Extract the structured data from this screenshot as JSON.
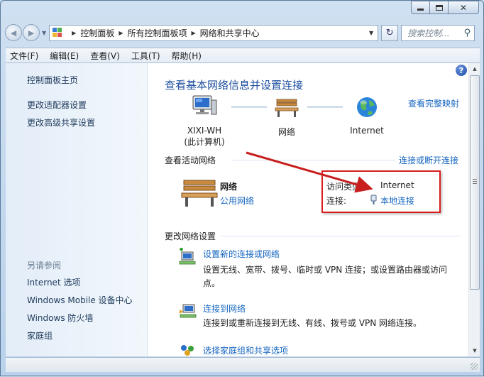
{
  "address_bar": {
    "breadcrumbs": [
      "控制面板",
      "所有控制面板项",
      "网络和共享中心"
    ],
    "search_placeholder": "搜索控制..."
  },
  "menu": [
    "文件(F)",
    "编辑(E)",
    "查看(V)",
    "工具(T)",
    "帮助(H)"
  ],
  "sidebar": {
    "top_links": [
      "控制面板主页",
      "更改适配器设置",
      "更改高级共享设置"
    ],
    "see_also_title": "另请参阅",
    "see_also_links": [
      "Internet 选项",
      "Windows Mobile 设备中心",
      "Windows 防火墙",
      "家庭组"
    ]
  },
  "main": {
    "heading": "查看基本网络信息并设置连接",
    "full_map_link": "查看完整映射",
    "nodes": [
      {
        "label": "XIXI-WH",
        "sublabel": "(此计算机)",
        "icon": "computer-icon"
      },
      {
        "label": "网络",
        "icon": "bench-icon"
      },
      {
        "label": "Internet",
        "icon": "globe-icon"
      }
    ],
    "active_networks": {
      "title": "查看活动网络",
      "connect_link": "连接或断开连接",
      "network_name": "网络",
      "network_type": "公用网络",
      "access_type_label": "访问类型:",
      "access_type_value": "Internet",
      "connection_label": "连接:",
      "connection_value": "本地连接"
    },
    "change_settings": {
      "title": "更改网络设置",
      "items": [
        {
          "link": "设置新的连接或网络",
          "desc_line1": "设置无线、宽带、拨号、临时或 VPN 连接；或设置路由器或访问",
          "desc_line2": "点。",
          "icon": "new-connection-icon"
        },
        {
          "link": "连接到网络",
          "desc_line1": "连接到或重新连接到无线、有线、拨号或 VPN 网络连接。",
          "icon": "connect-network-icon"
        },
        {
          "link": "选择家庭组和共享选项",
          "icon": "homegroup-icon"
        }
      ]
    }
  },
  "colors": {
    "link": "#1565c0",
    "heading": "#1e4f9e",
    "annotation": "#d71d1d"
  }
}
